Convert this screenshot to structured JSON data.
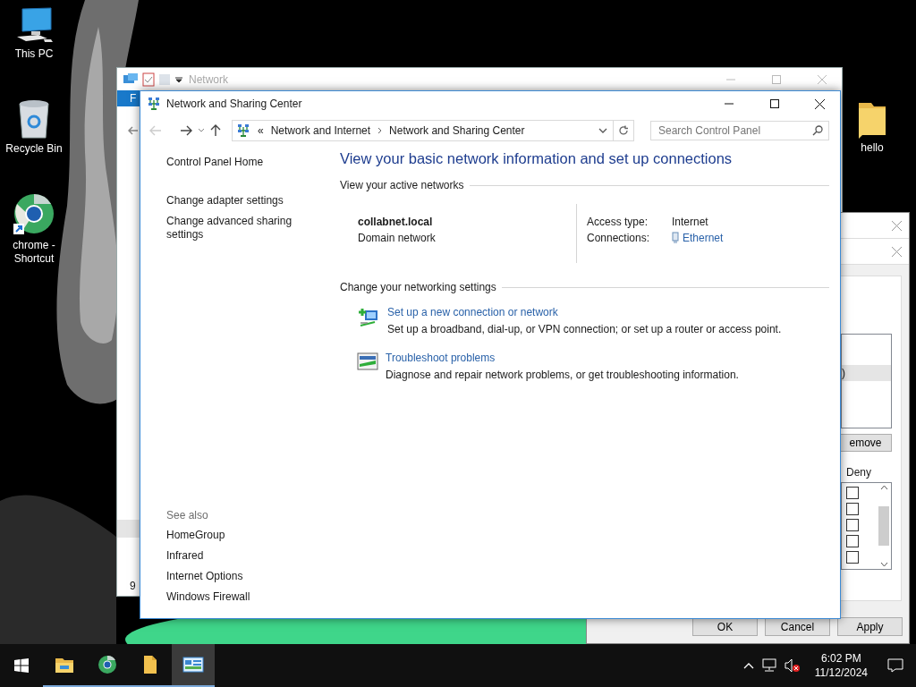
{
  "desktop": {
    "icons": [
      {
        "label": "This PC",
        "kind": "pc"
      },
      {
        "label": "Recycle Bin",
        "kind": "bin"
      },
      {
        "label": "chrome - Shortcut",
        "kind": "chrome"
      },
      {
        "label": "hello",
        "kind": "folder"
      }
    ]
  },
  "background_window": {
    "title": "Network",
    "ribbon_tab": "F",
    "status": "9"
  },
  "dialog": {
    "list_item": ")",
    "remove_button": "emove",
    "column": "Deny",
    "permissions": [
      {
        "checked": false
      },
      {
        "checked": false
      },
      {
        "checked": false
      },
      {
        "checked": false
      },
      {
        "checked": false
      }
    ],
    "buttons": [
      "OK",
      "Cancel",
      "Apply"
    ]
  },
  "window": {
    "title": "Network and Sharing Center",
    "address": {
      "overflow": "«",
      "path": [
        "Network and Internet",
        "Network and Sharing Center"
      ]
    },
    "search": {
      "placeholder": "Search Control Panel"
    },
    "sidebar": {
      "links": [
        "Control Panel Home",
        "Change adapter settings",
        "Change advanced sharing settings"
      ],
      "see_also_title": "See also",
      "see_also": [
        "HomeGroup",
        "Infrared",
        "Internet Options",
        "Windows Firewall"
      ]
    },
    "heading": "View your basic network information and set up connections",
    "active_networks": {
      "title": "View your active networks",
      "name": "collabnet.local",
      "category": "Domain network",
      "access_label": "Access type:",
      "access_value": "Internet",
      "connections_label": "Connections:",
      "connection": "Ethernet"
    },
    "settings": {
      "title": "Change your networking settings",
      "tasks": [
        {
          "kind": "new_connection",
          "link": "Set up a new connection or network",
          "description": "Set up a broadband, dial-up, or VPN connection; or set up a router or access point."
        },
        {
          "kind": "troubleshoot",
          "link": "Troubleshoot problems",
          "description": "Diagnose and repair network problems, or get troubleshooting information."
        }
      ]
    }
  },
  "taskbar": {
    "apps": [
      {
        "kind": "explorer",
        "selected": false
      },
      {
        "kind": "chrome",
        "selected": false
      },
      {
        "kind": "files",
        "selected": false
      },
      {
        "kind": "control_panel",
        "selected": true
      }
    ],
    "time": "6:02 PM",
    "date": "11/12/2024"
  }
}
